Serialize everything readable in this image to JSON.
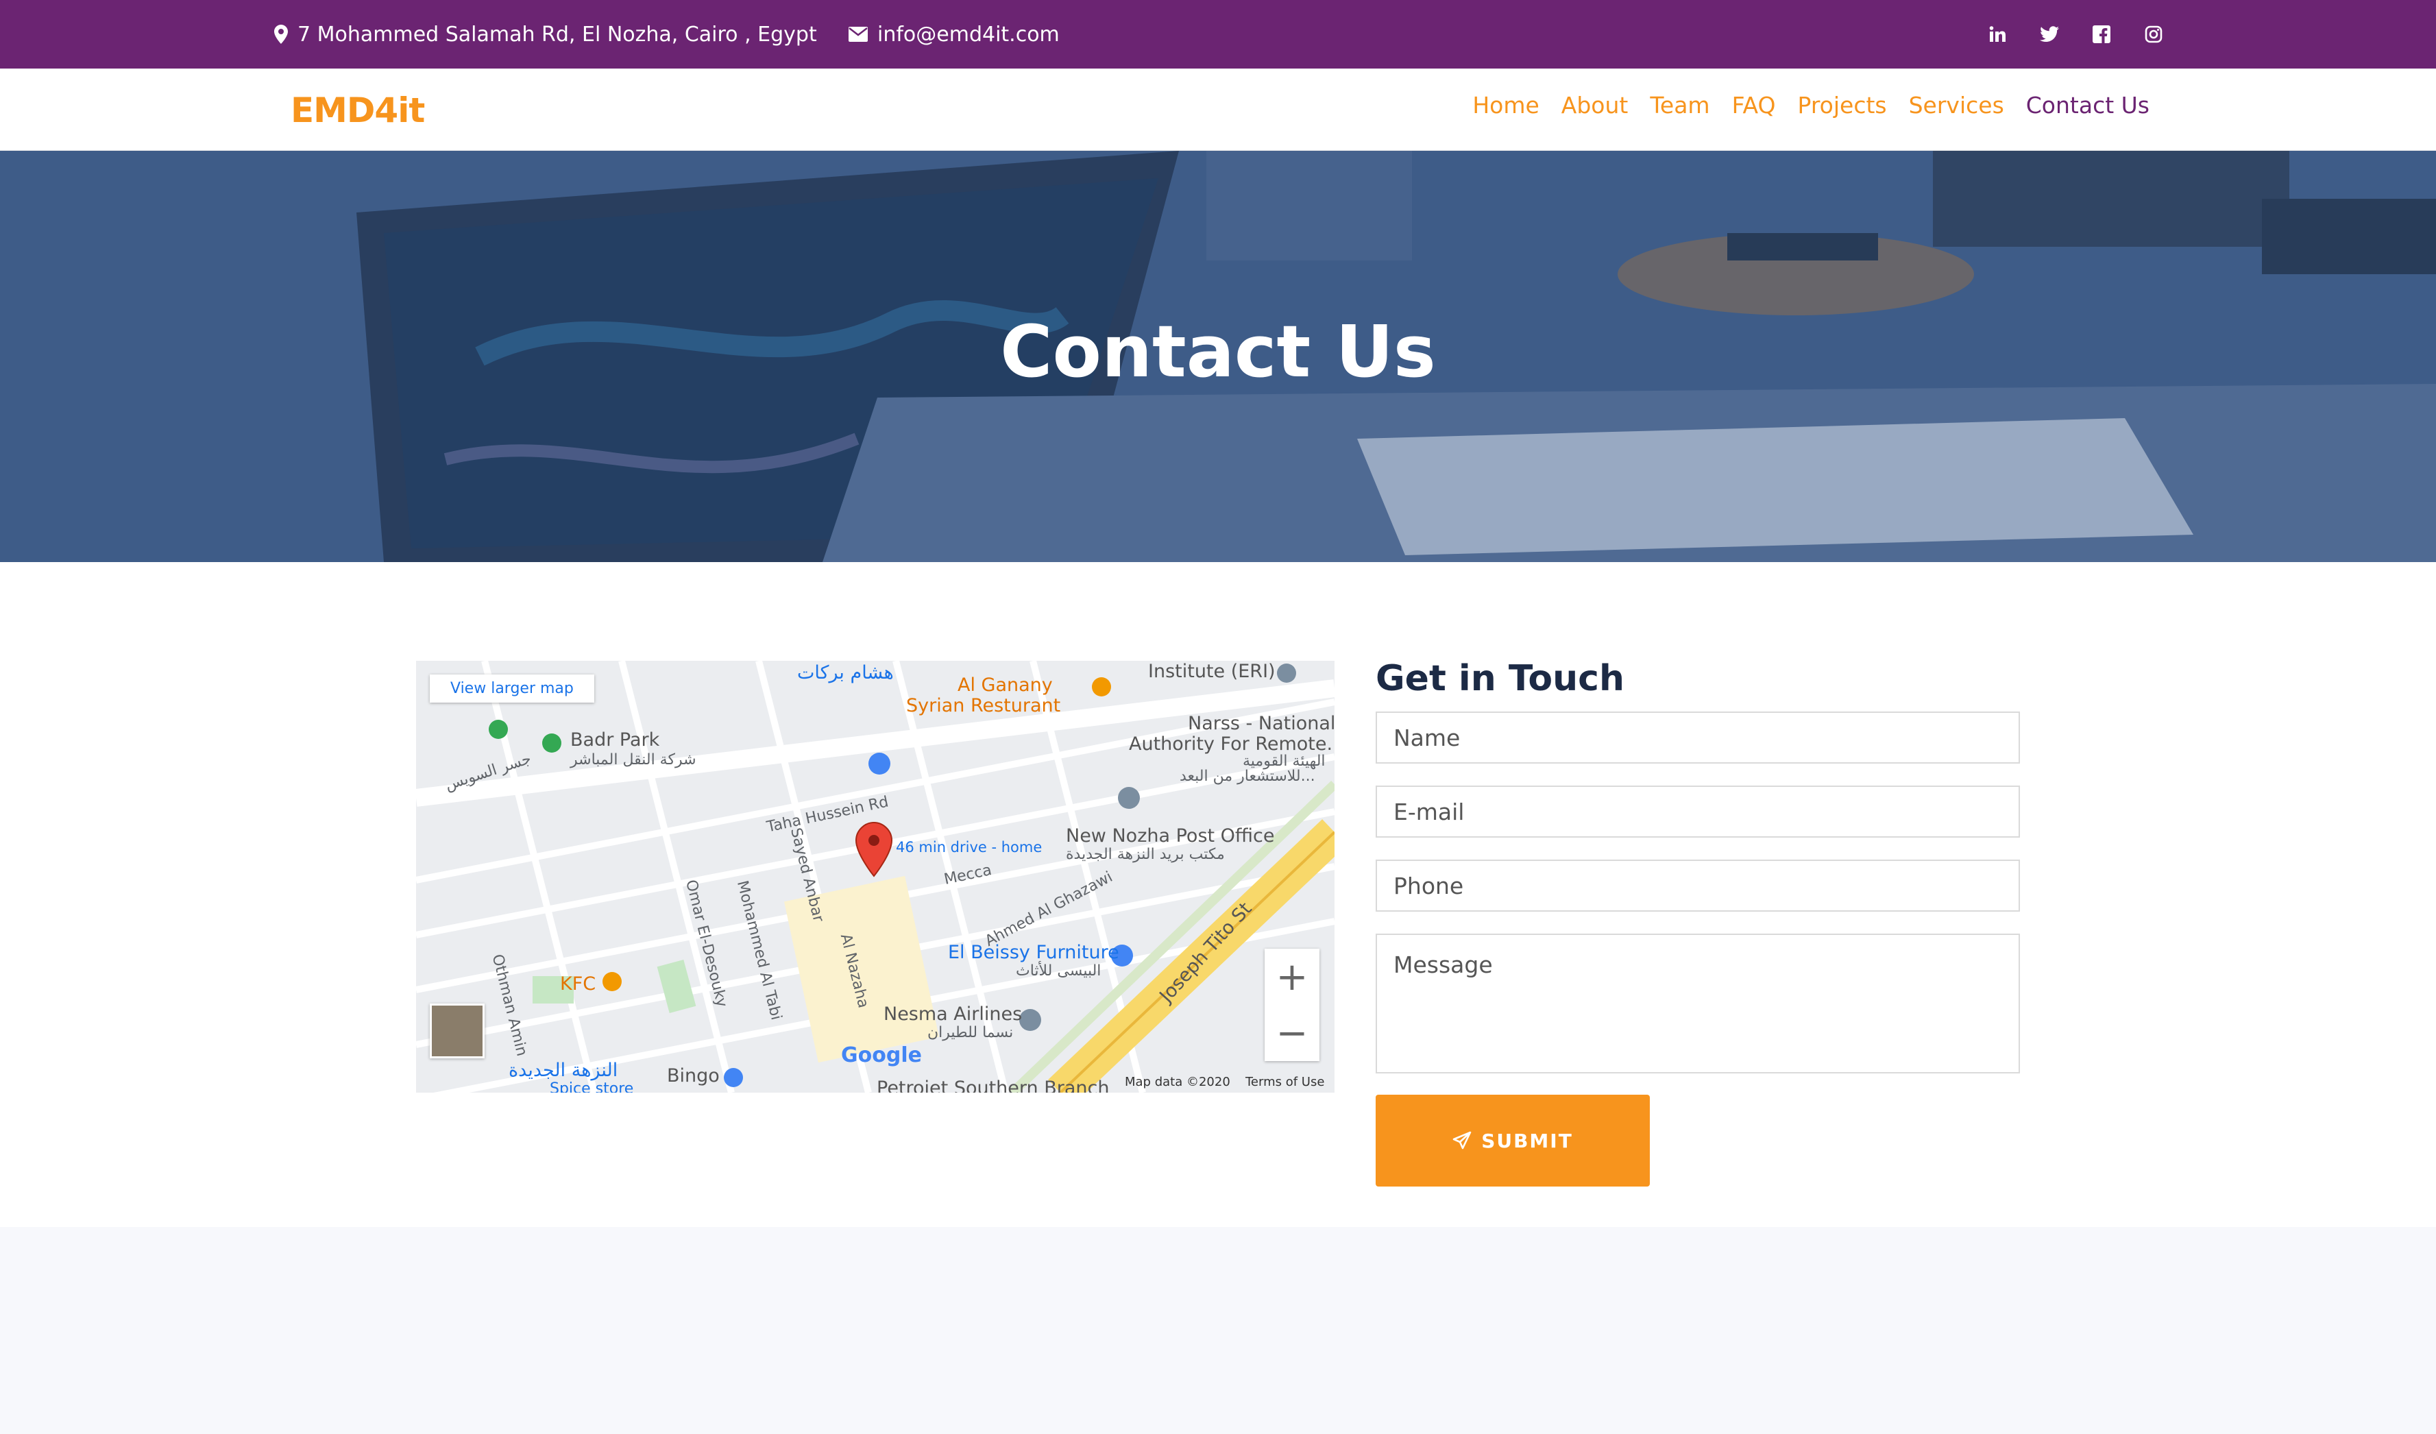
{
  "topbar": {
    "address": "7 Mohammed Salamah Rd, El Nozha, Cairo , Egypt",
    "email": "info@emd4it.com",
    "social_icons": [
      "linkedin-icon",
      "twitter-icon",
      "facebook-icon",
      "instagram-icon"
    ]
  },
  "brand": {
    "logo_text": "EMD4it",
    "primary_color": "#6b2472",
    "accent_color": "#f7941d"
  },
  "nav": {
    "items": [
      {
        "label": "Home"
      },
      {
        "label": "About"
      },
      {
        "label": "Team"
      },
      {
        "label": "FAQ"
      },
      {
        "label": "Projects"
      },
      {
        "label": "Services"
      },
      {
        "label": "Contact Us"
      }
    ],
    "active": "Contact Us"
  },
  "hero": {
    "title": "Contact Us"
  },
  "map": {
    "view_larger": "View larger map",
    "drive_time": "46 min drive - home",
    "attribution_data": "Map data ©2020",
    "attribution_terms": "Terms of Use",
    "google": "Google",
    "labels": [
      "Badr Park",
      "شركة النقل المباشر",
      "Al Ganany",
      "Syrian Resturant",
      "Institute (ERI)",
      "Narss - National",
      "Authority For Remote...",
      "الهيئة القومية",
      "للاستشعار من البعد...",
      "New Nozha Post Office",
      "مكتب بريد النزهة الجديدة",
      "El Beissy Furniture",
      "البيسى للأثاث",
      "Nesma Airlines",
      "نسما للطيران",
      "KFC",
      "Bingo",
      "النزهة الجديدة",
      "Spice store",
      "Petrojet Southern Branch",
      "Taha Hussein Rd",
      "Mecca",
      "Ahmed Al Ghazawi",
      "Joseph Tito St",
      "Sayed Anbar",
      "Al Nazaha",
      "Mohammed Al Tabi",
      "Omar El-Desouky",
      "Othman Amin",
      "هشام بركات",
      "جسر السويس"
    ]
  },
  "form": {
    "title": "Get in Touch",
    "name_placeholder": "Name",
    "email_placeholder": "E-mail",
    "phone_placeholder": "Phone",
    "message_placeholder": "Message",
    "submit_label": "SUBMIT"
  }
}
